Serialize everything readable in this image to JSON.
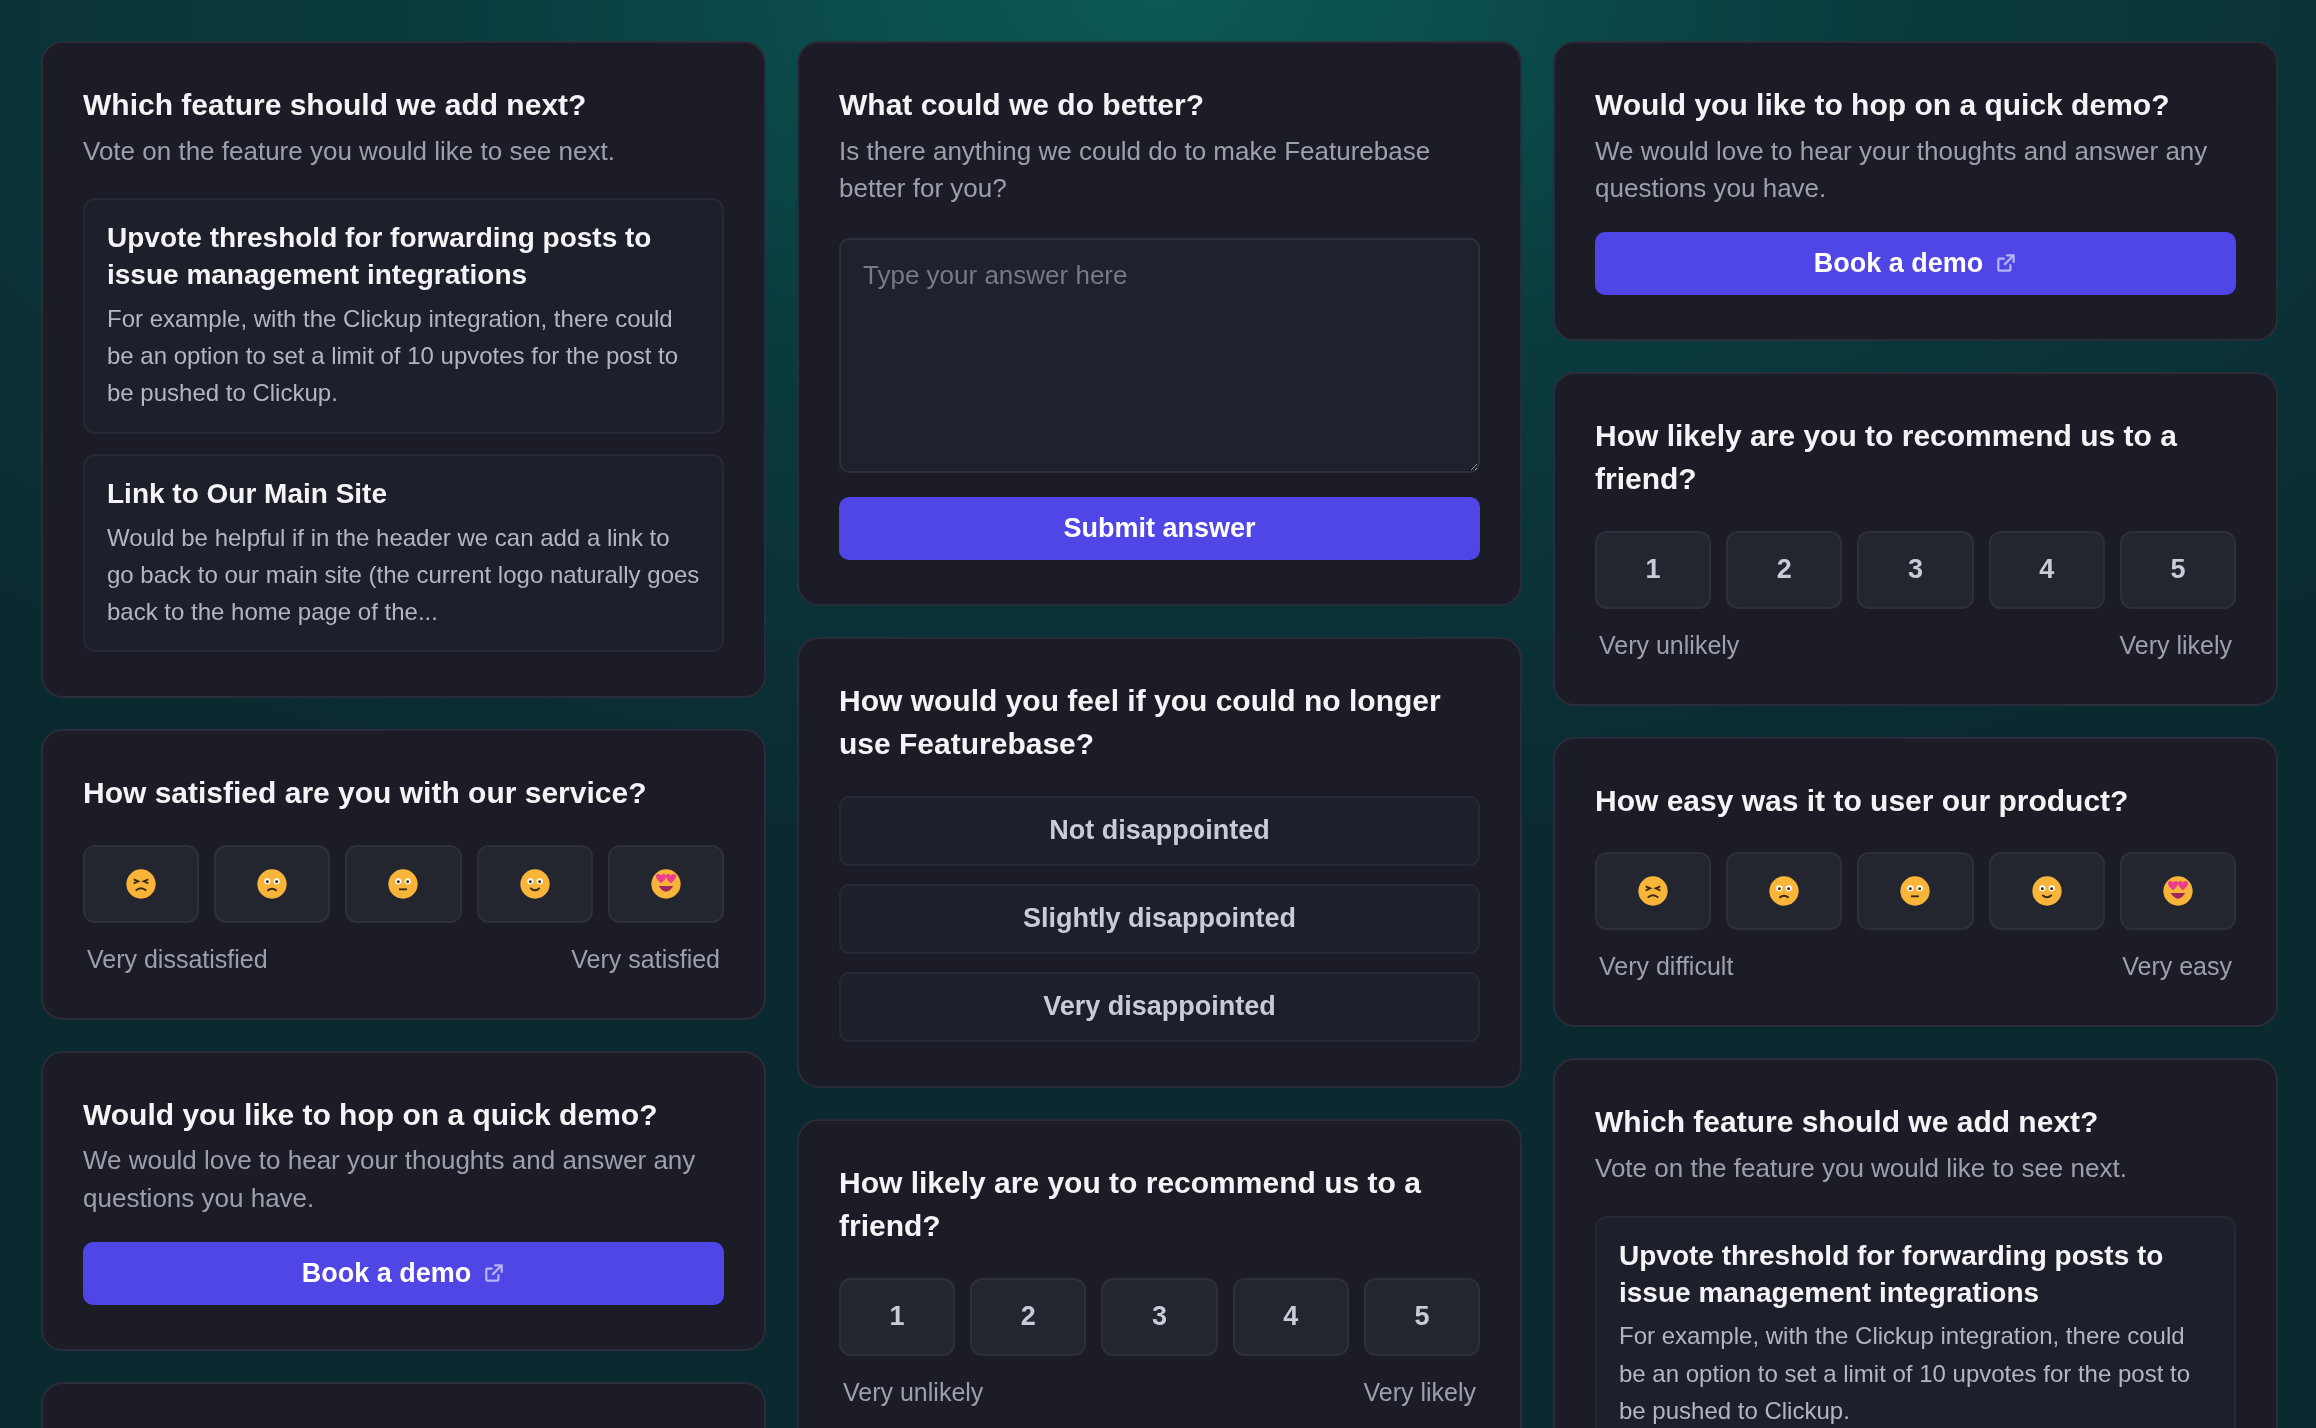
{
  "columns": [
    {
      "cards": [
        {
          "kind": "feature_vote",
          "title": "Which feature should we add next?",
          "subtitle": "Vote on the feature you would like to see next.",
          "items": [
            {
              "title": "Upvote threshold for forwarding posts to issue management integrations",
              "description": "For example, with the Clickup integration, there could be an option to set a limit of 10 upvotes for the post to be pushed to Clickup."
            },
            {
              "title": "Link to Our Main Site",
              "description": "Would be helpful if in the header we can add a link to go back to our main site (the current logo naturally goes back to the home page of the..."
            }
          ]
        },
        {
          "kind": "emoji",
          "title": "How satisfied are you with our service?",
          "low_label": "Very dissatisfied",
          "high_label": "Very satisfied"
        },
        {
          "kind": "demo",
          "title": "Would you like to hop on a quick demo?",
          "subtitle": "We would love to hear your thoughts and answer any questions you have.",
          "button": "Book a demo"
        },
        {
          "kind": "empty"
        }
      ]
    },
    {
      "cards": [
        {
          "kind": "text_answer",
          "title": "What could we do better?",
          "subtitle": "Is there anything we could do to make Featurebase better for you?",
          "placeholder": "Type your answer here",
          "button": "Submit answer"
        },
        {
          "kind": "choice",
          "title": "How would you feel if you could no longer use Featurebase?",
          "options": [
            "Not disappointed",
            "Slightly disappointed",
            "Very disappointed"
          ]
        },
        {
          "kind": "nps",
          "title": "How likely are you to recommend us to a friend?",
          "scale": [
            "1",
            "2",
            "3",
            "4",
            "5"
          ],
          "low_label": "Very unlikely",
          "high_label": "Very likely"
        }
      ]
    },
    {
      "cards": [
        {
          "kind": "demo",
          "title": "Would you like to hop on a quick demo?",
          "subtitle": "We would love to hear your thoughts and answer any questions you have.",
          "button": "Book a demo"
        },
        {
          "kind": "nps",
          "title": "How likely are you to recommend us to a friend?",
          "scale": [
            "1",
            "2",
            "3",
            "4",
            "5"
          ],
          "low_label": "Very unlikely",
          "high_label": "Very likely"
        },
        {
          "kind": "emoji",
          "title": "How easy was it to user our product?",
          "low_label": "Very difficult",
          "high_label": "Very easy"
        },
        {
          "kind": "feature_vote",
          "title": "Which feature should we add next?",
          "subtitle": "Vote on the feature you would like to see next.",
          "items": [
            {
              "title": "Upvote threshold for forwarding posts to issue management integrations",
              "description": "For example, with the Clickup integration, there could be an option to set a limit of 10 upvotes for the post to be pushed to Clickup."
            }
          ]
        }
      ]
    }
  ]
}
